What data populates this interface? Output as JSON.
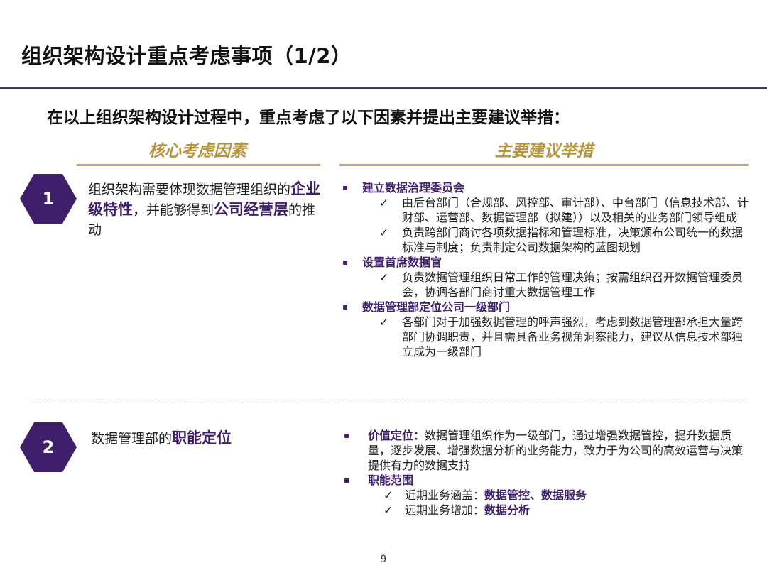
{
  "title": "组织架构设计重点考虑事项（1/2）",
  "subtitle": "在以上组织架构设计过程中，重点考虑了以下因素并提出主要建议举措：",
  "columns": {
    "left": "核心考虑因素",
    "right": "主要建议举措"
  },
  "section1": {
    "number": "1",
    "factor_pre": "组织架构需要体现数据管理组织的",
    "factor_em1": "企业级特性",
    "factor_mid": "，并能够得到",
    "factor_em2": "公司经营层",
    "factor_post": "的推动",
    "bullet_marker": "▪",
    "check_marker": "✓",
    "measures": [
      {
        "heading": "建立数据治理委员会",
        "checks": [
          "由后台部门（合规部、风控部、审计部）、中台部门（信息技术部、计财部、运营部、数据管理部（拟建））以及相关的业务部门领导组成",
          "负责跨部门商讨各项数据指标和管理标准，决策颁布公司统一的数据标准与制度；负责制定公司数据架构的蓝图规划"
        ]
      },
      {
        "heading": "设置首席数据官",
        "checks": [
          "负责数据管理组织日常工作的管理决策；按需组织召开数据管理委员会，协调各部门商讨重大数据管理工作"
        ]
      },
      {
        "heading": "数据管理部定位公司一级部门",
        "checks": [
          "各部门对于加强数据管理的呼声强烈，考虑到数据管理部承担大量跨部门协调职责，并且需具备业务视角洞察能力，建议从信息技术部独立成为一级部门"
        ]
      }
    ]
  },
  "section2": {
    "number": "2",
    "factor_pre": "数据管理部的",
    "factor_em": "职能定位",
    "value_label": "价值定位：",
    "value_text": "数据管理组织作为一级部门，通过增强数据管控，提升数据质量，逐步发展、增强数据分析的业务能力，致力于为公司的高效运营与决策提供有力的数据支持",
    "scope_label": "职能范围",
    "near_label": "近期业务涵盖：",
    "near_value": "数据管控、数据服务",
    "far_label": "远期业务增加：",
    "far_value": "数据分析"
  },
  "page_number": "9"
}
